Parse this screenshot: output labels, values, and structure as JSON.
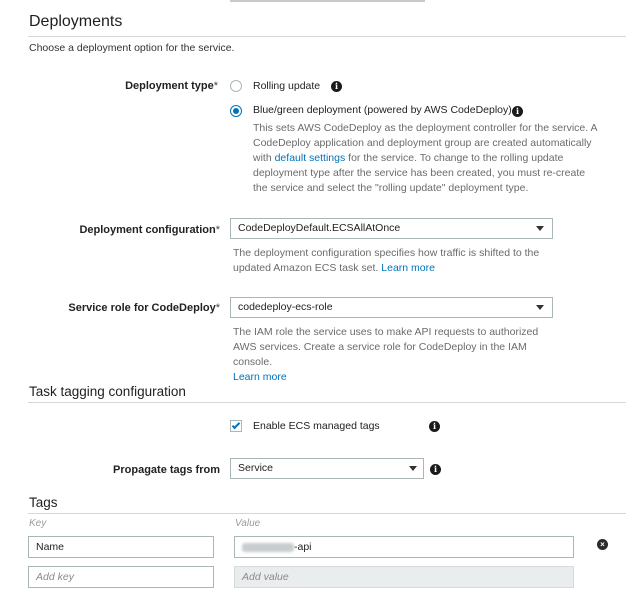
{
  "deployments": {
    "title": "Deployments",
    "subtitle": "Choose a deployment option for the service.",
    "deployment_type": {
      "label": "Deployment type",
      "required_mark": "*",
      "options": [
        {
          "label": "Rolling update",
          "selected": false,
          "icon": "info-icon"
        },
        {
          "label": "Blue/green deployment (powered by AWS CodeDeploy)",
          "selected": true,
          "icon": "info-icon"
        }
      ],
      "help_part1": "This sets AWS CodeDeploy as the deployment controller for the service. A CodeDeploy application and deployment group are created automatically with ",
      "help_link": "default settings",
      "help_part2": " for the service. To change to the rolling update deployment type after the service has been created, you must re-create the service and select the \"rolling update\" deployment type."
    },
    "deployment_configuration": {
      "label": "Deployment configuration",
      "required_mark": "*",
      "value": "CodeDeployDefault.ECSAllAtOnce",
      "help": "The deployment configuration specifies how traffic is shifted to the updated Amazon ECS task set. ",
      "help_link": "Learn more"
    },
    "service_role": {
      "label": "Service role for CodeDeploy",
      "required_mark": "*",
      "value": "codedeploy-ecs-role",
      "help": "The IAM role the service uses to make API requests to authorized AWS services. Create a service role for CodeDeploy in the IAM console.",
      "help_link": "Learn more"
    }
  },
  "task_tagging": {
    "title": "Task tagging configuration",
    "enable_ecs_tags": {
      "label": "Enable ECS managed tags",
      "checked": true,
      "icon": "info-icon"
    },
    "propagate": {
      "label": "Propagate tags from",
      "value": "Service",
      "icon": "info-icon"
    }
  },
  "tags": {
    "title": "Tags",
    "key_header": "Key",
    "value_header": "Value",
    "rows": [
      {
        "key": "Name",
        "value_suffix": "-api",
        "value_redacted": true
      }
    ],
    "new_row": {
      "key_placeholder": "Add key",
      "value_placeholder": "Add value"
    }
  },
  "colors": {
    "accent": "#0073bb",
    "help_text": "#6b6b6b",
    "border": "#aab7b8"
  }
}
